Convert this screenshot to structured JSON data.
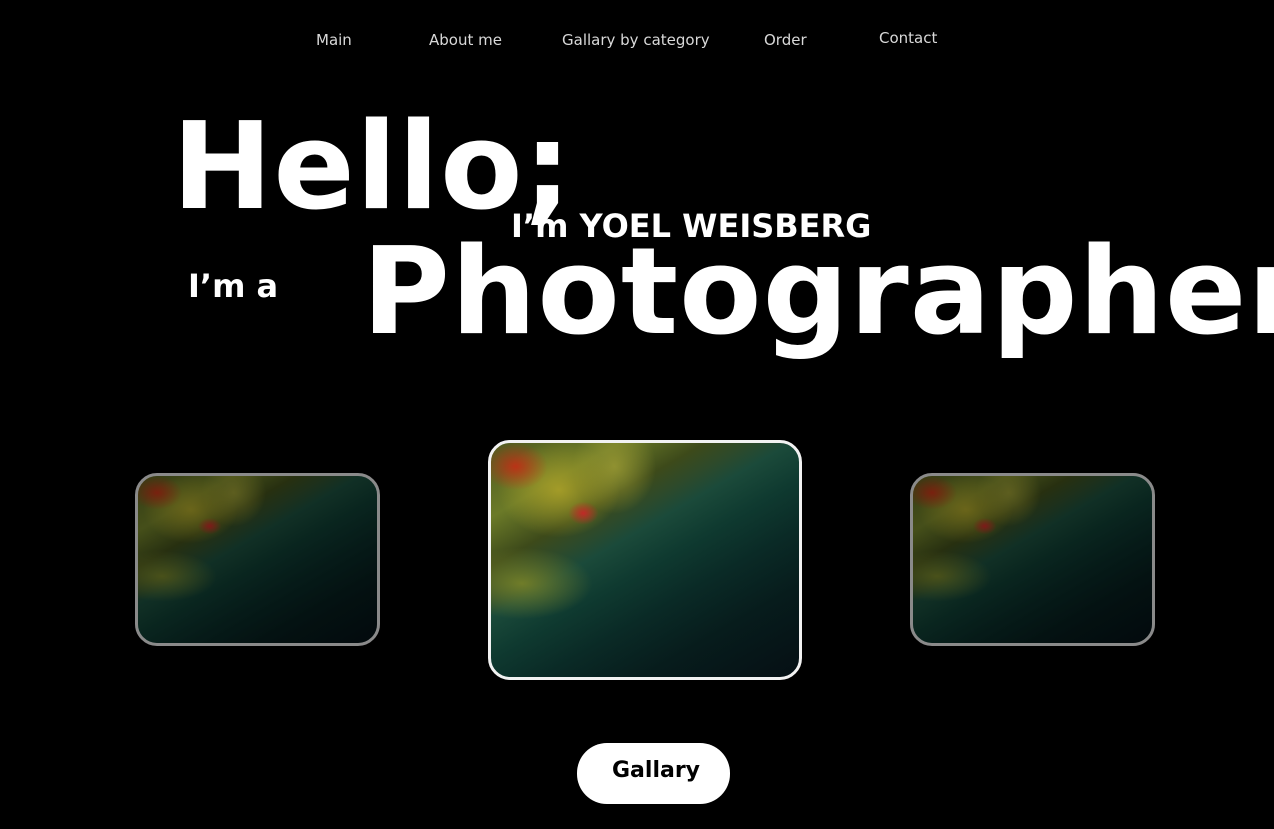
{
  "nav": {
    "items": [
      {
        "label": "Main"
      },
      {
        "label": "About me"
      },
      {
        "label": "Gallary by category"
      },
      {
        "label": "Order"
      },
      {
        "label": "Contact"
      }
    ]
  },
  "hero": {
    "hello": "Hello;",
    "name_line": "I’m YOEL WEISBERG",
    "im_a": "I’m a",
    "profession": "Photographer"
  },
  "carousel": {
    "active_index": 1,
    "count": 3
  },
  "cta": {
    "label": "Gallary"
  },
  "colors": {
    "background": "#000000",
    "text": "#ffffff",
    "nav_text": "#d9d9d9",
    "button_bg": "#ffffff",
    "button_text": "#000000"
  }
}
